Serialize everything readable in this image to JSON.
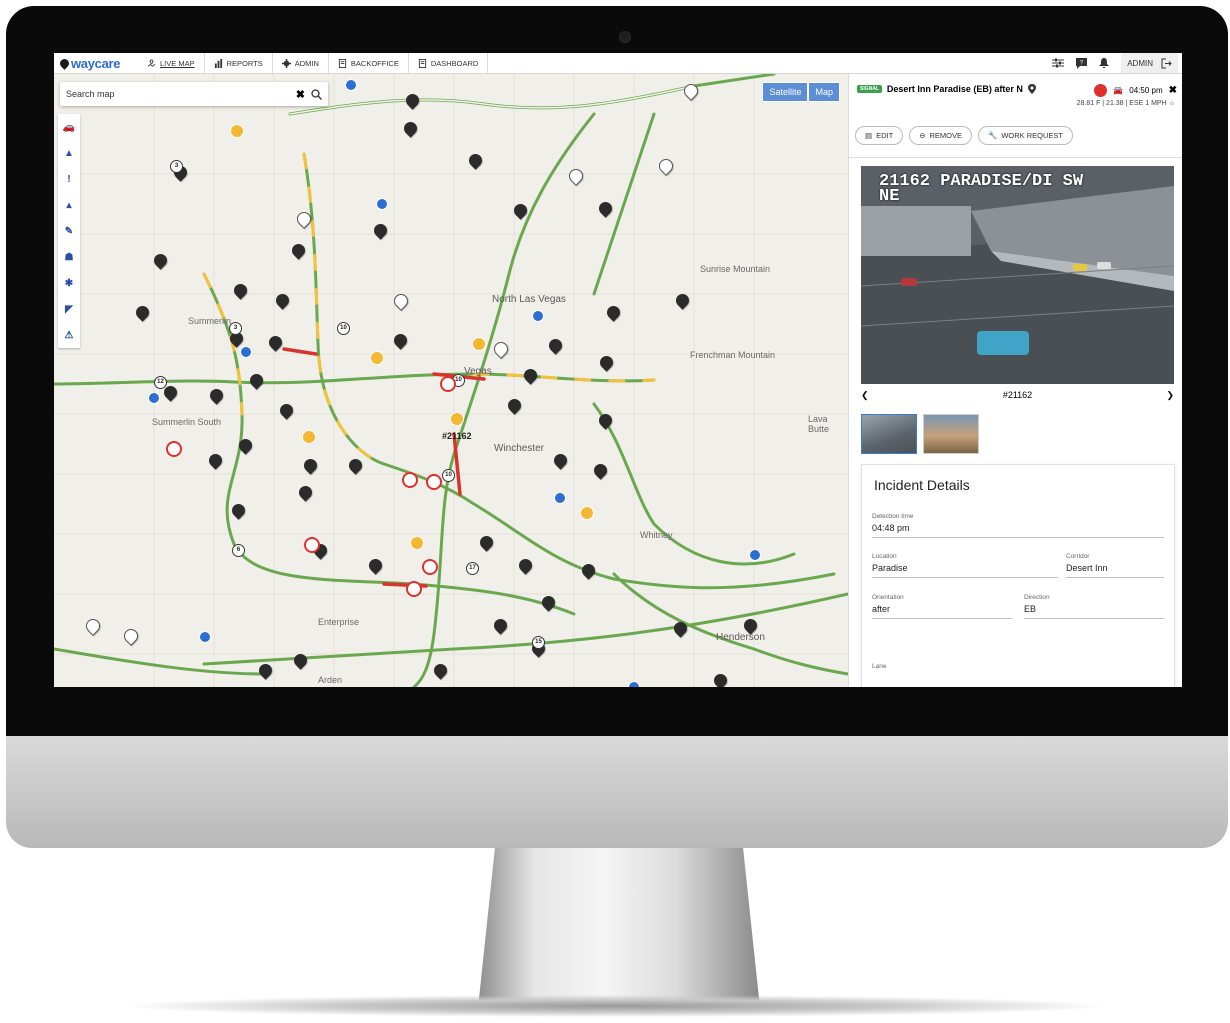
{
  "app": {
    "logo": "waycare",
    "nav": [
      {
        "label": "LIVE MAP",
        "icon": "map-icon",
        "active": true
      },
      {
        "label": "REPORTS",
        "icon": "bar-chart-icon"
      },
      {
        "label": "ADMIN",
        "icon": "gear-icon"
      },
      {
        "label": "BACKOFFICE",
        "icon": "document-icon"
      },
      {
        "label": "DASHBOARD",
        "icon": "document-icon"
      }
    ],
    "user": "ADMIN"
  },
  "map": {
    "search_placeholder": "Search map",
    "map_types": [
      "Satellite",
      "Map"
    ],
    "places": [
      {
        "name": "North Las Vegas"
      },
      {
        "name": "Summerlin"
      },
      {
        "name": "Summerlin South"
      },
      {
        "name": "Winchester"
      },
      {
        "name": "Whitney"
      },
      {
        "name": "Henderson"
      },
      {
        "name": "Enterprise"
      },
      {
        "name": "Sunrise Mountain"
      },
      {
        "name": "Frenchman Mountain"
      },
      {
        "name": "Lava Butte"
      },
      {
        "name": "Arden"
      },
      {
        "name": "Vegas"
      },
      {
        "name": "#21162"
      }
    ]
  },
  "panel": {
    "title": "Desert Inn Paradise (EB) after N",
    "badge": "SIGNAL",
    "time": "04:50 pm",
    "weather": "28.81 F | 21.38 | ESE 1 MPH",
    "buttons": {
      "edit": "EDIT",
      "remove": "REMOVE",
      "work_request": "WORK REQUEST"
    },
    "camera": {
      "caption": "21162 PARADISE/DI SW\nNE",
      "id": "#21162"
    },
    "details": {
      "heading": "Incident Details",
      "detection_label": "Detection time",
      "detection_value": "04:48 pm",
      "location_label": "Location",
      "location_value": "Paradise",
      "corridor_label": "Corridor",
      "corridor_value": "Desert Inn",
      "orientation_label": "Orientation",
      "orientation_value": "after",
      "direction_label": "Direction",
      "direction_value": "EB",
      "lane_label": "Lane"
    }
  }
}
